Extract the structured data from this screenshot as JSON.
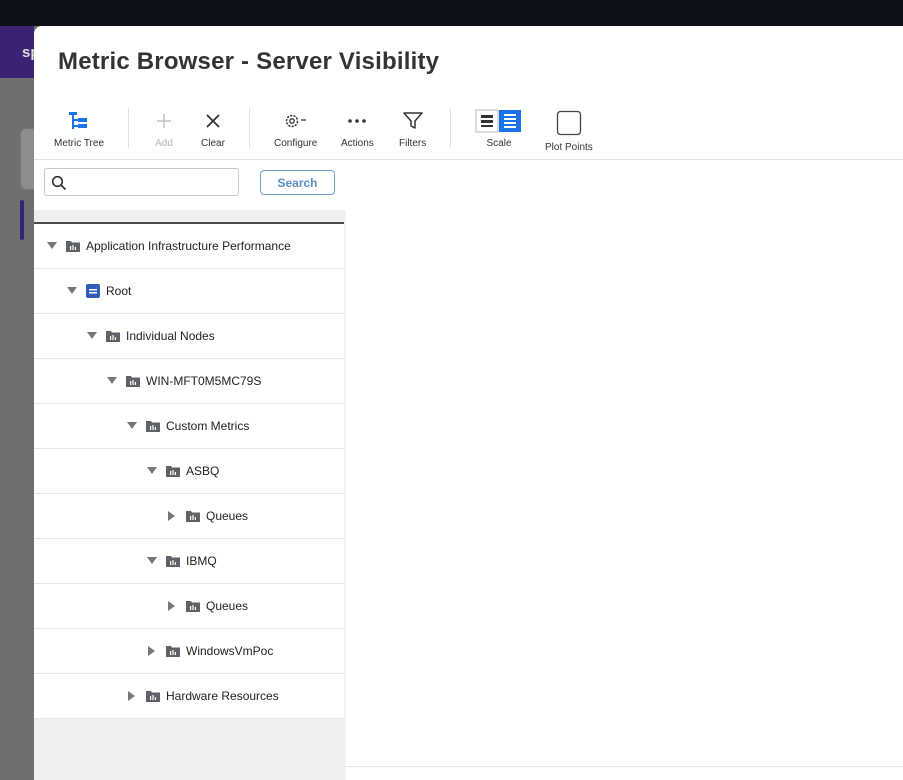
{
  "backdrop": {
    "nav_text": "sp"
  },
  "modal": {
    "title": "Metric Browser - Server Visibility"
  },
  "toolbar": {
    "metric_tree": "Metric Tree",
    "add": "Add",
    "clear": "Clear",
    "configure": "Configure",
    "actions": "Actions",
    "filters": "Filters",
    "scale": "Scale",
    "plot_points": "Plot Points"
  },
  "search": {
    "placeholder": "",
    "value": "",
    "button": "Search"
  },
  "tree": [
    {
      "label": "Application Infrastructure Performance",
      "depth": 0,
      "expanded": true,
      "icon": "folder-chart-icon"
    },
    {
      "label": "Root",
      "depth": 1,
      "expanded": true,
      "icon": "root-icon"
    },
    {
      "label": "Individual Nodes",
      "depth": 2,
      "expanded": true,
      "icon": "folder-chart-icon"
    },
    {
      "label": "WIN-MFT0M5MC79S",
      "depth": 3,
      "expanded": true,
      "icon": "folder-chart-icon"
    },
    {
      "label": "Custom Metrics",
      "depth": 4,
      "expanded": true,
      "icon": "folder-chart-icon"
    },
    {
      "label": "ASBQ",
      "depth": 5,
      "expanded": true,
      "icon": "folder-chart-icon"
    },
    {
      "label": "Queues",
      "depth": 6,
      "expanded": false,
      "icon": "folder-chart-icon"
    },
    {
      "label": "IBMQ",
      "depth": 5,
      "expanded": true,
      "icon": "folder-chart-icon"
    },
    {
      "label": "Queues",
      "depth": 6,
      "expanded": false,
      "icon": "folder-chart-icon"
    },
    {
      "label": "WindowsVmPoc",
      "depth": 5,
      "expanded": false,
      "icon": "folder-chart-icon"
    },
    {
      "label": "Hardware Resources",
      "depth": 4,
      "expanded": false,
      "icon": "folder-chart-icon"
    }
  ],
  "colors": {
    "accent": "#1a73e8",
    "search_border": "#6a9fd6",
    "folder": "#5f6368",
    "root_icon": "#2f5db8"
  }
}
